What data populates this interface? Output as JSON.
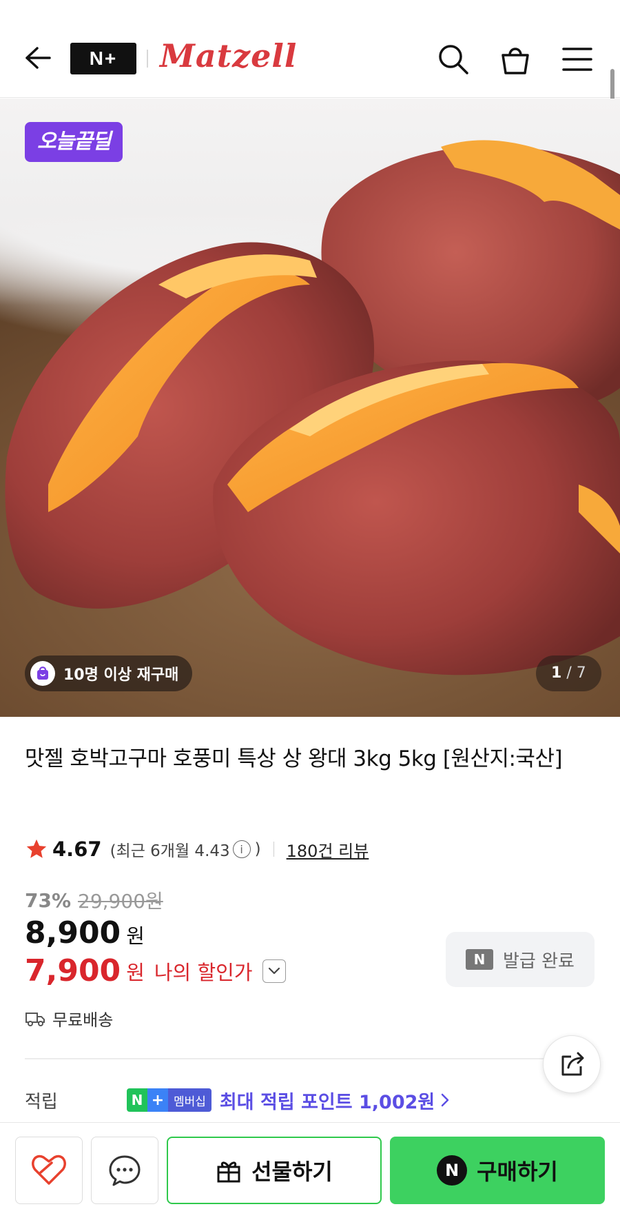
{
  "header": {
    "nplus_logo": "N+",
    "brand_name": "Matzell"
  },
  "hero": {
    "deal_badge": "오늘끝딜",
    "repurchase": "10명 이상 재구매",
    "page_current": "1",
    "page_separator": "/",
    "page_total": "7"
  },
  "product": {
    "title": "맛젤 호박고구마 호풍미 특상 상 왕대 3kg 5kg [원산지:국산]",
    "rating": "4.67",
    "rating_recent": "(최근 6개월 4.43",
    "rating_recent_close": ")",
    "info_symbol": "i",
    "review_count": "180건 리뷰",
    "discount_rate": "73%",
    "original_price": "29,900원",
    "sale_price": "8,900",
    "won": "원",
    "my_price": "7,900",
    "my_price_label": "나의 할인가",
    "coupon_mark": "N",
    "coupon_label": "발급 완료",
    "shipping": "무료배송",
    "points_label": "적립",
    "membership_n": "N",
    "membership_plus": "+",
    "membership_text": "멤버십",
    "points_text": "최대 적립 포인트 1,002원"
  },
  "bottom": {
    "gift_label": "선물하기",
    "buy_mark": "N",
    "buy_label": "구매하기"
  },
  "colors": {
    "brand_red": "#d93a3f",
    "deal_purple": "#7b3fe4",
    "price_red": "#d9262c",
    "naver_green": "#3dd160",
    "points_purple": "#5b4ee4"
  },
  "icons": [
    "back-arrow-icon",
    "search-icon",
    "cart-icon",
    "menu-icon",
    "bag-icon",
    "info-icon",
    "chevron-down-icon",
    "truck-icon",
    "share-icon",
    "heart-icon",
    "chat-icon",
    "gift-icon",
    "chevron-right-icon"
  ]
}
